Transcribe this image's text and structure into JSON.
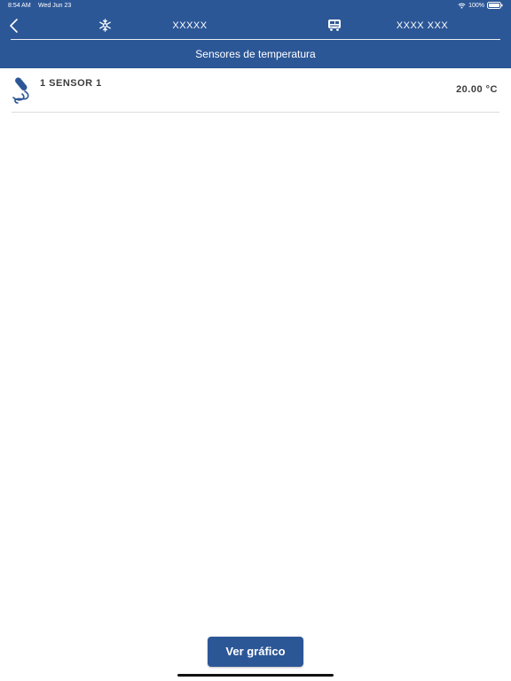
{
  "status_bar": {
    "time": "8:54 AM",
    "date": "Wed Jun 23",
    "battery": "100%",
    "icons": [
      "wifi-icon",
      "battery-icon"
    ]
  },
  "nav": {
    "back_icon": "chevron-left-icon",
    "unit_icon": "snowflake-icon",
    "unit_name": "XXXXX",
    "vehicle_icon": "truck-icon",
    "vehicle_plate": "XXXX XXX"
  },
  "page": {
    "title": "Sensores de temperatura"
  },
  "sensors": [
    {
      "icon": "thermometer-probe-icon",
      "name": "1 SENSOR 1",
      "temperature": "20.00 °C"
    }
  ],
  "actions": {
    "chart_button": "Ver gráfico"
  },
  "colors": {
    "primary": "#2c5797",
    "text_dark": "#3c3c3c",
    "divider": "#dddddd",
    "background": "#ffffff"
  }
}
